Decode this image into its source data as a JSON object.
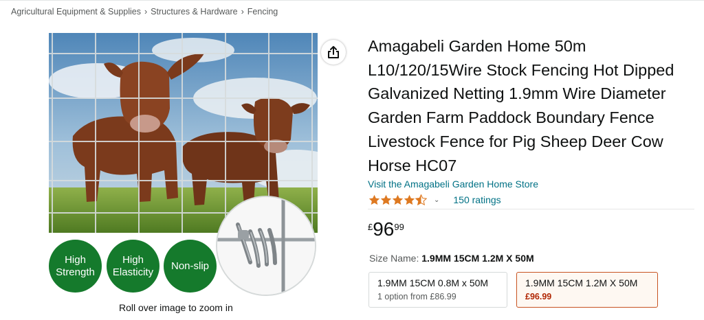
{
  "breadcrumb": {
    "items": [
      "Agricultural Equipment & Supplies",
      "Structures & Hardware",
      "Fencing"
    ],
    "separator": "›"
  },
  "product": {
    "title": "Amagabeli Garden Home 50m L10/120/15Wire Stock Fencing Hot Dipped Galvanized Netting 1.9mm Wire Diameter Garden Farm Paddock Boundary Fence Livestock Fence for Pig Sheep Deer Cow Horse HC07",
    "store_link": "Visit the Amagabeli Garden Home Store",
    "rating_stars": 4.5,
    "ratings_text": "150 ratings",
    "price": {
      "symbol": "£",
      "whole": "96",
      "fraction": "99"
    }
  },
  "image": {
    "badges": [
      "High Strength",
      "High Elasticity",
      "Non-slip"
    ],
    "zoom_hint": "Roll over image to zoom in"
  },
  "size": {
    "label": "Size Name:",
    "selected": "1.9MM 15CM 1.2M X 50M",
    "options": [
      {
        "name": "1.9MM 15CM 0.8M x 50M",
        "sub": "1 option from £86.99"
      },
      {
        "name": "1.9MM 15CM 1.2M X 50M",
        "price": "£96.99"
      }
    ]
  },
  "colors": {
    "link": "#007185",
    "star": "#de7921",
    "badge_green": "#157a2c",
    "price_red": "#b12704",
    "selected_border": "#c7511f"
  },
  "icons": [
    "share-icon",
    "star-icon",
    "chevron-down-icon"
  ]
}
